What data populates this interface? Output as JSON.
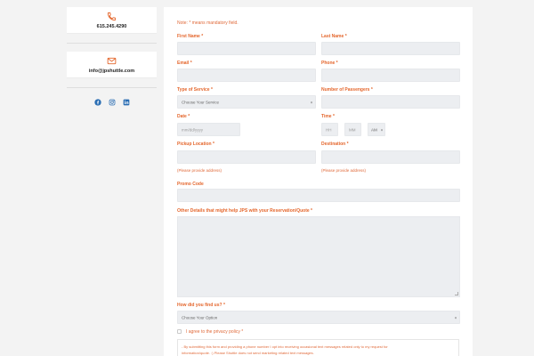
{
  "sidebar": {
    "phone": "615.245.4290",
    "email": "info@jpshuttle.com",
    "socials": [
      "facebook-icon",
      "instagram-icon",
      "linkedin-icon"
    ]
  },
  "colors": {
    "accent": "#e4662c",
    "field_bg": "#eceef1",
    "page_bg": "#f3f3f3",
    "social": "#2a6db3"
  },
  "form": {
    "note": "Note: * means mandatory field.",
    "first_name": {
      "label": "First Name",
      "req": "*",
      "value": ""
    },
    "last_name": {
      "label": "Last Name",
      "req": "*",
      "value": ""
    },
    "email": {
      "label": "Email",
      "req": "*",
      "value": ""
    },
    "phone": {
      "label": "Phone",
      "req": "*",
      "value": ""
    },
    "service": {
      "label": "Type of Service",
      "req": "*",
      "selected": "Choose Your Service"
    },
    "passengers": {
      "label": "Number of Passengers",
      "req": "*",
      "value": ""
    },
    "date": {
      "label": "Date",
      "req": "*",
      "placeholder": "mm/dd/yyyy"
    },
    "time": {
      "label": "Time",
      "req": "*",
      "hh": "HH",
      "mm": "MM",
      "ampm": "AM"
    },
    "pickup": {
      "label": "Pickup Location",
      "req": "*",
      "hint": "(Please provide address)"
    },
    "destination": {
      "label": "Destination",
      "req": "*",
      "hint": "(Please provide address)"
    },
    "promo": {
      "label": "Promo Code",
      "value": ""
    },
    "details": {
      "label": "Other Details that might help JPS with your Reservation/Quote",
      "req": "*"
    },
    "found": {
      "label": "How did you find us?",
      "req": "*",
      "selected": "Choose Your Option"
    },
    "privacy": {
      "label": "I agree to the privacy policy",
      "req": "*"
    },
    "consent_lines": [
      "- By submitting this form and providing a phone number I opt into receiving occasional text messages related only to my request for",
      "information/quote. :) Please Shuttle does not send marketing related text messages."
    ]
  }
}
